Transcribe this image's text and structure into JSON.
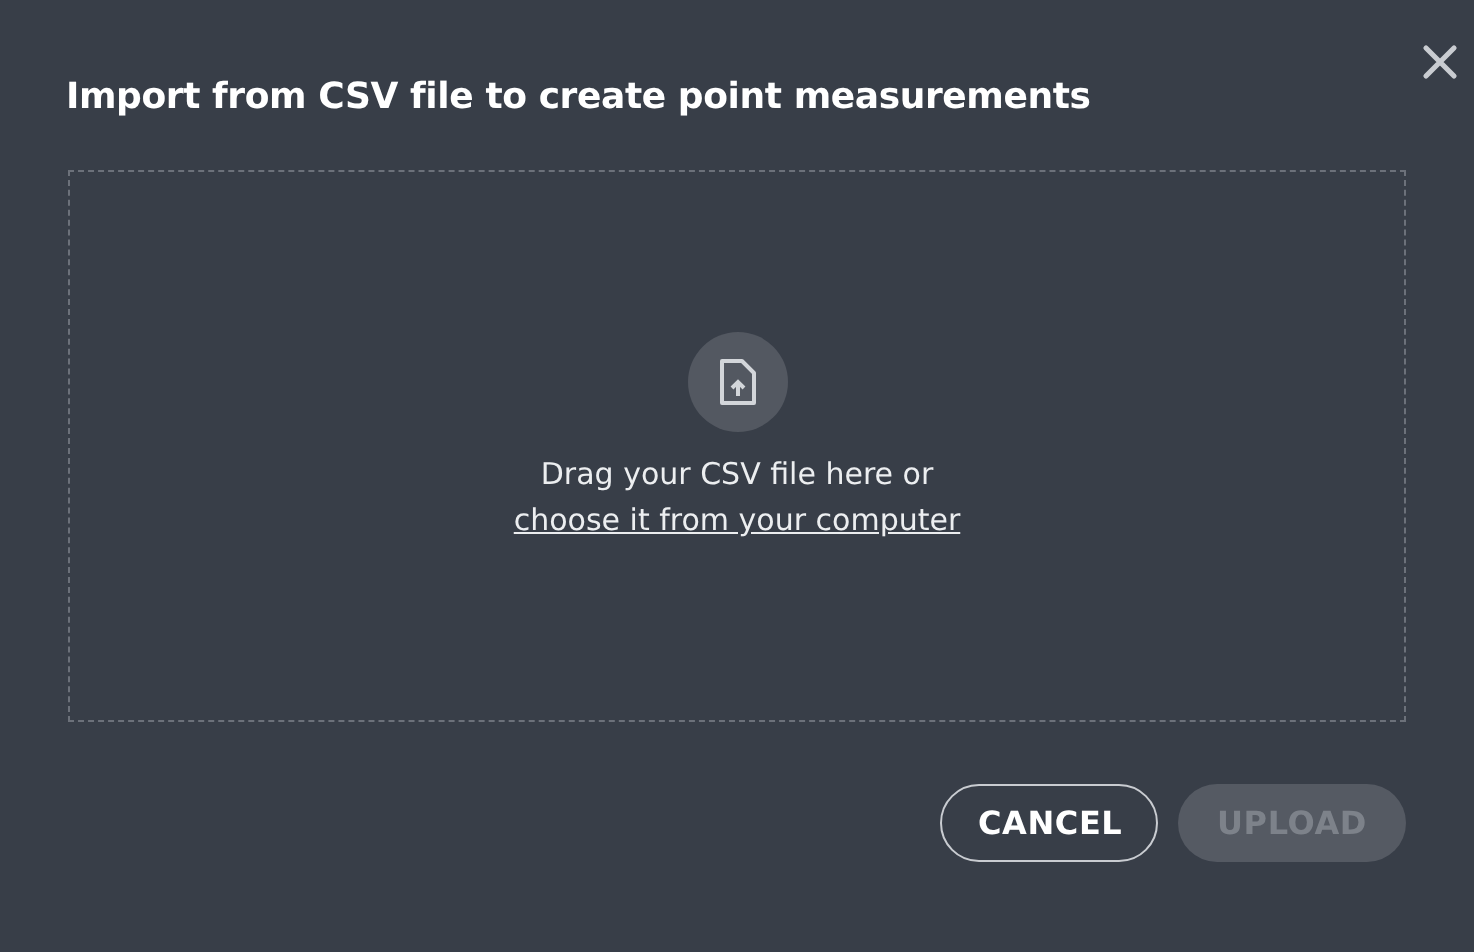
{
  "dialog": {
    "title": "Import from CSV file to create point measurements"
  },
  "dropzone": {
    "prompt": "Drag your CSV file here or",
    "link": "choose it from your computer"
  },
  "buttons": [
    {
      "label": "CANCEL",
      "kind": "outline",
      "disabled": false
    },
    {
      "label": "UPLOAD",
      "kind": "filled",
      "disabled": true
    }
  ]
}
